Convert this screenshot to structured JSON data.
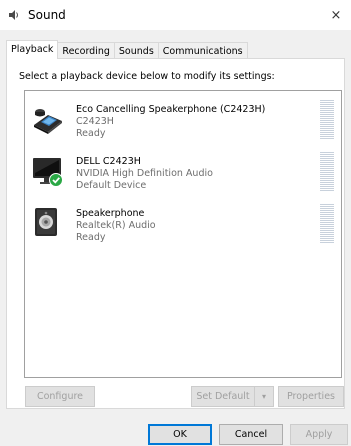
{
  "window": {
    "title": "Sound",
    "icon": "speaker-icon",
    "close_glyph": "×"
  },
  "tabs": [
    {
      "label": "Playback",
      "active": true
    },
    {
      "label": "Recording",
      "active": false
    },
    {
      "label": "Sounds",
      "active": false
    },
    {
      "label": "Communications",
      "active": false
    }
  ],
  "playback": {
    "instruction": "Select a playback device below to modify its settings:",
    "devices": [
      {
        "name": "Eco Cancelling Speakerphone (C2423H)",
        "line2": "C2423H",
        "line3": "Ready",
        "icon": "speakerphone-device-icon",
        "is_default": false
      },
      {
        "name": "DELL C2423H",
        "line2": "NVIDIA High Definition Audio",
        "line3": "Default Device",
        "icon": "monitor-device-icon",
        "is_default": true
      },
      {
        "name": "Speakerphone",
        "line2": "Realtek(R) Audio",
        "line3": "Ready",
        "icon": "speaker-device-icon",
        "is_default": false
      }
    ]
  },
  "actions": {
    "configure": "Configure",
    "set_default": "Set Default",
    "set_default_arrow": "▾",
    "properties": "Properties"
  },
  "footer": {
    "ok": "OK",
    "cancel": "Cancel",
    "apply": "Apply"
  },
  "colors": {
    "accent": "#0078d7",
    "default_check": "#2aa845",
    "disabled_text": "#a0a0a0"
  }
}
